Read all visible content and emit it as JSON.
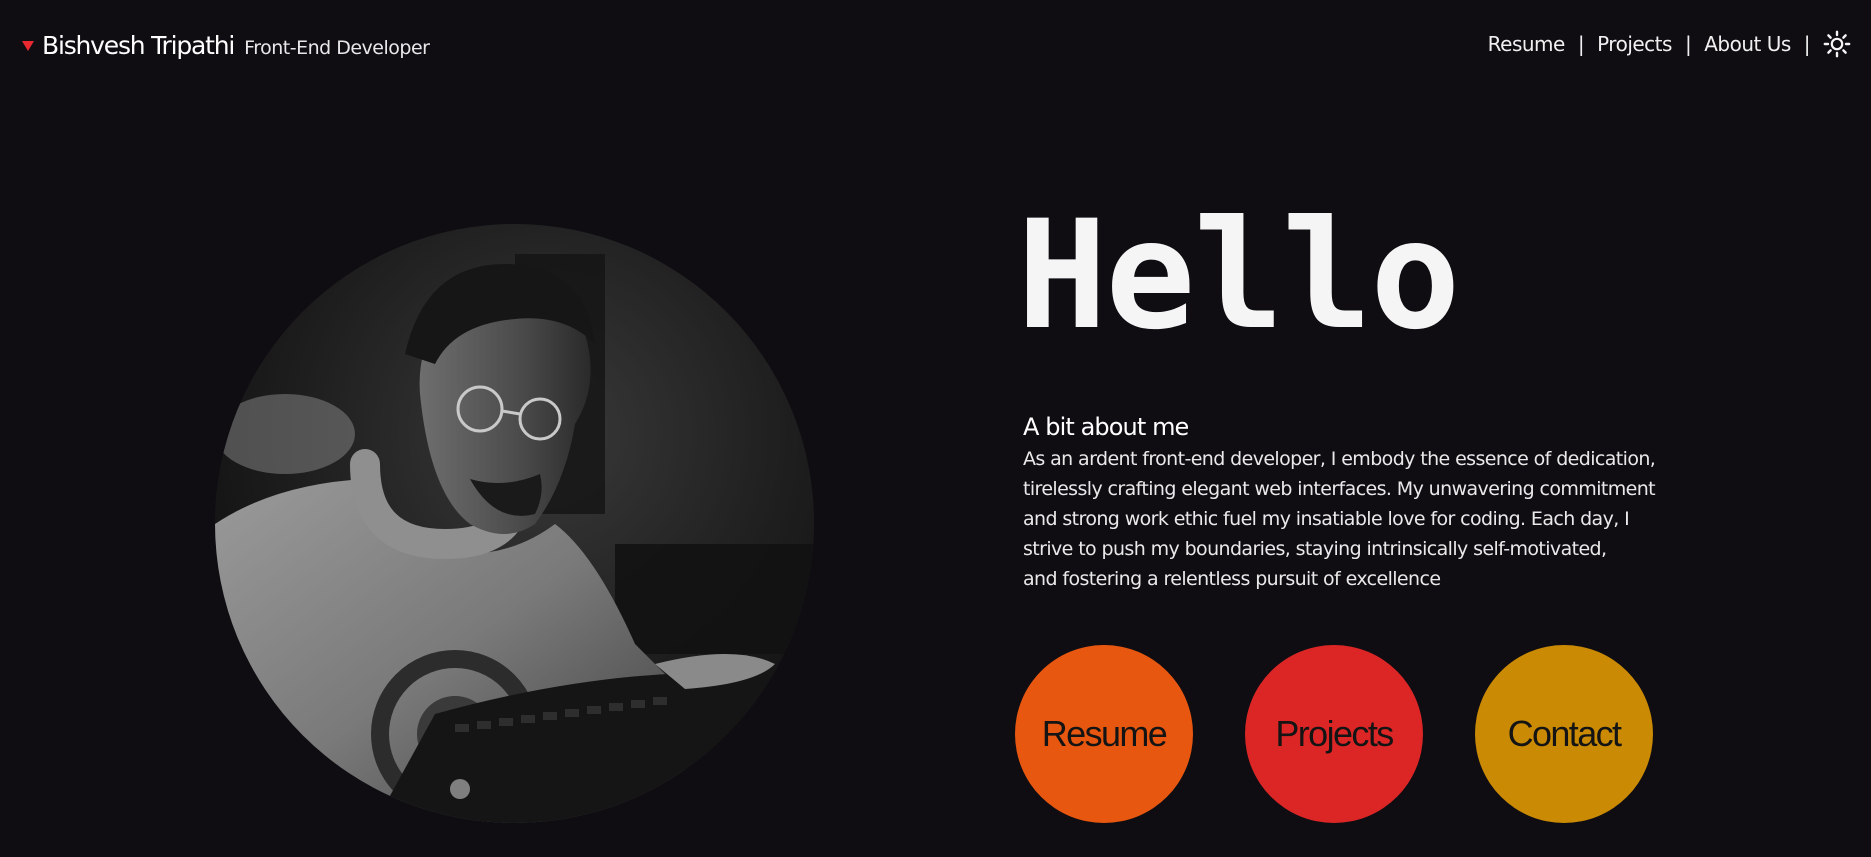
{
  "header": {
    "brand_name": "Bishvesh Tripathi",
    "brand_role": "Front-End Developer",
    "nav": [
      {
        "label": "Resume"
      },
      {
        "label": "Projects"
      },
      {
        "label": "About Us"
      }
    ],
    "separator": "|",
    "theme_toggle_icon": "sun-icon"
  },
  "hero": {
    "greeting": "Hello",
    "portrait_icon": "profile-photo",
    "about_title": "A bit about me",
    "about_lines": [
      "As an ardent front-end developer, I embody the essence of dedication,",
      "tirelessly crafting elegant web interfaces. My unwavering commitment",
      "and strong work ethic fuel my insatiable love for coding. Each day, I",
      "strive to push my boundaries, staying intrinsically self-motivated,",
      "and fostering a relentless pursuit of excellence"
    ]
  },
  "actions": [
    {
      "label": "Resume",
      "color": "#e8570f"
    },
    {
      "label": "Projects",
      "color": "#dc2626"
    },
    {
      "label": "Contact",
      "color": "#ca8a04"
    }
  ],
  "colors": {
    "background": "#0f0d12",
    "accent_marker": "#e8292f",
    "text": "#f2f2f2"
  }
}
